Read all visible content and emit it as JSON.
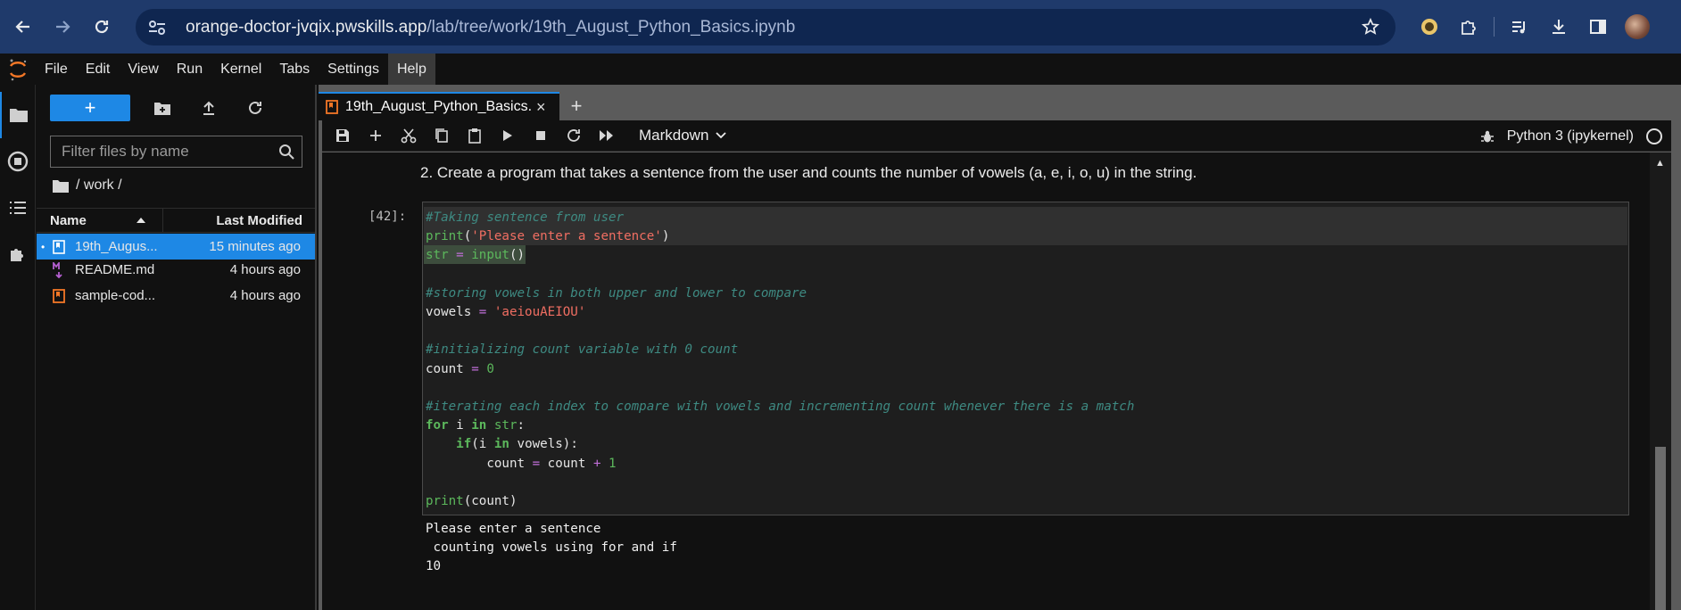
{
  "browser": {
    "url_host": "orange-doctor-jvqix.pwskills.app",
    "url_path": "/lab/tree/work/19th_August_Python_Basics.ipynb"
  },
  "menu": [
    "File",
    "Edit",
    "View",
    "Run",
    "Kernel",
    "Tabs",
    "Settings",
    "Help"
  ],
  "filebrowser": {
    "new_label": "+",
    "filter_placeholder": "Filter files by name",
    "breadcrumb": "/ work /",
    "col_name": "Name",
    "col_modified": "Last Modified",
    "files": [
      {
        "name": "19th_Augus...",
        "modified": "15 minutes ago",
        "type": "notebook"
      },
      {
        "name": "README.md",
        "modified": "4 hours ago",
        "type": "markdown"
      },
      {
        "name": "sample-cod...",
        "modified": "4 hours ago",
        "type": "notebook"
      }
    ]
  },
  "tab": {
    "title": "19th_August_Python_Basics.ipynb",
    "close": "×",
    "add": "+"
  },
  "toolbar": {
    "cell_type": "Markdown",
    "kernel": "Python 3 (ipykernel)"
  },
  "notebook": {
    "markdown": "2. Create a program that takes a sentence from the user and counts the number of vowels (a, e, i, o, u) in the string.",
    "prompt": "[42]:",
    "code_lines": [
      "#Taking sentence from user",
      "print('Please enter a sentence')",
      "str = input()",
      "",
      "#storing vowels in both upper and lower to compare",
      "vowels = 'aeiouAEIOU'",
      "",
      "#initializing count variable with 0 count",
      "count = 0",
      "",
      "#iterating each index to compare with vowels and incrementing count whenever there is a match",
      "for i in str:",
      "    if(i in vowels):",
      "        count = count + 1",
      "",
      "print(count)"
    ],
    "output_lines": [
      "Please enter a sentence",
      " counting vowels using for and if",
      "10"
    ]
  }
}
